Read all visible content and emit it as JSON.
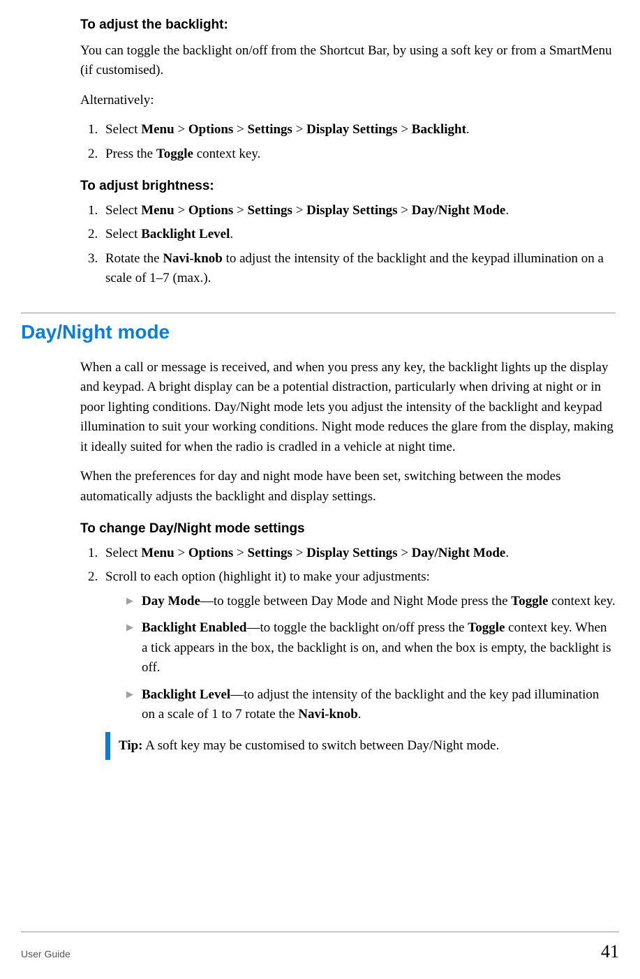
{
  "sec1": {
    "heading": "To adjust the backlight:",
    "intro": "You can toggle the backlight on/off from the Shortcut Bar, by using a soft key or from a SmartMenu (if customised).",
    "alt": "Alternatively:",
    "step1_prefix": "Select ",
    "step1_path": [
      "Menu",
      "Options",
      "Settings",
      "Display Settings",
      "Backlight"
    ],
    "step2_a": "Press the ",
    "step2_b": "Toggle",
    "step2_c": " context key."
  },
  "sec2": {
    "heading": "To adjust brightness:",
    "step1_prefix": "Select ",
    "step1_path": [
      "Menu",
      "Options",
      "Settings",
      "Display Settings",
      "Day/Night Mode"
    ],
    "step2_a": "Select ",
    "step2_b": "Backlight Level",
    "step2_c": ".",
    "step3_a": "Rotate the ",
    "step3_b": "Navi-knob",
    "step3_c": " to adjust the intensity of the backlight and the keypad illumination on a scale of 1–7 (max.)."
  },
  "sec3": {
    "title": "Day/Night mode",
    "p1": "When a call or message is received, and when you press any key, the backlight lights up the display and keypad. A bright display can be a potential distraction, particularly when driving at night or in poor lighting conditions. Day/Night mode lets you adjust the intensity of the backlight and keypad illumination to suit your working conditions. Night mode reduces the glare from the display, making it ideally suited for when the radio is cradled in a vehicle at night time.",
    "p2": "When the preferences for day and night mode have been set, switching between the modes automatically adjusts the backlight and display settings.",
    "heading": "To change Day/Night mode settings",
    "step1_prefix": "Select ",
    "step1_path": [
      "Menu",
      "Options",
      "Settings",
      "Display Settings",
      "Day/Night Mode"
    ],
    "step2": "Scroll to each option (highlight it) to make your adjustments:",
    "b1_a": "Day Mode",
    "b1_b": "—to toggle between Day Mode and Night Mode press the ",
    "b1_c": "Toggle",
    "b1_d": " context key.",
    "b2_a": "Backlight Enabled",
    "b2_b": "—to toggle the backlight on/off press the ",
    "b2_c": "Toggle",
    "b2_d": " context key. When a tick appears in the box, the backlight is on, and when the box is empty, the backlight is off.",
    "b3_a": "Backlight Level",
    "b3_b": "—to adjust the intensity of the backlight and the key pad illumination on a scale of 1 to 7 rotate the ",
    "b3_c": "Navi-knob",
    "b3_d": ".",
    "tip_a": "Tip:",
    "tip_b": "  A soft key may be customised to switch between Day/Night mode."
  },
  "footer": {
    "left": "User Guide",
    "page": "41"
  },
  "sep": " > "
}
